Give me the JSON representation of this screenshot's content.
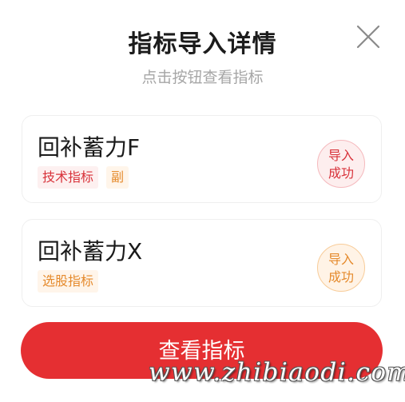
{
  "dialog": {
    "title": "指标导入详情",
    "subtitle": "点击按钮查看指标"
  },
  "close_icon": "close-x-icon",
  "indicators": [
    {
      "name": "回补蓄力F",
      "tags": [
        "技术指标",
        "副"
      ],
      "status_line1": "导入",
      "status_line2": "成功"
    },
    {
      "name": "回补蓄力X",
      "tags": [
        "选股指标"
      ],
      "status_line1": "导入",
      "status_line2": "成功"
    }
  ],
  "action_button": {
    "label": "查看指标"
  },
  "watermark": "www.zhibiaodi.com",
  "colors": {
    "accent_red": "#e52f32",
    "tag_red_text": "#d8323a",
    "tag_orange_text": "#e58a2c"
  }
}
